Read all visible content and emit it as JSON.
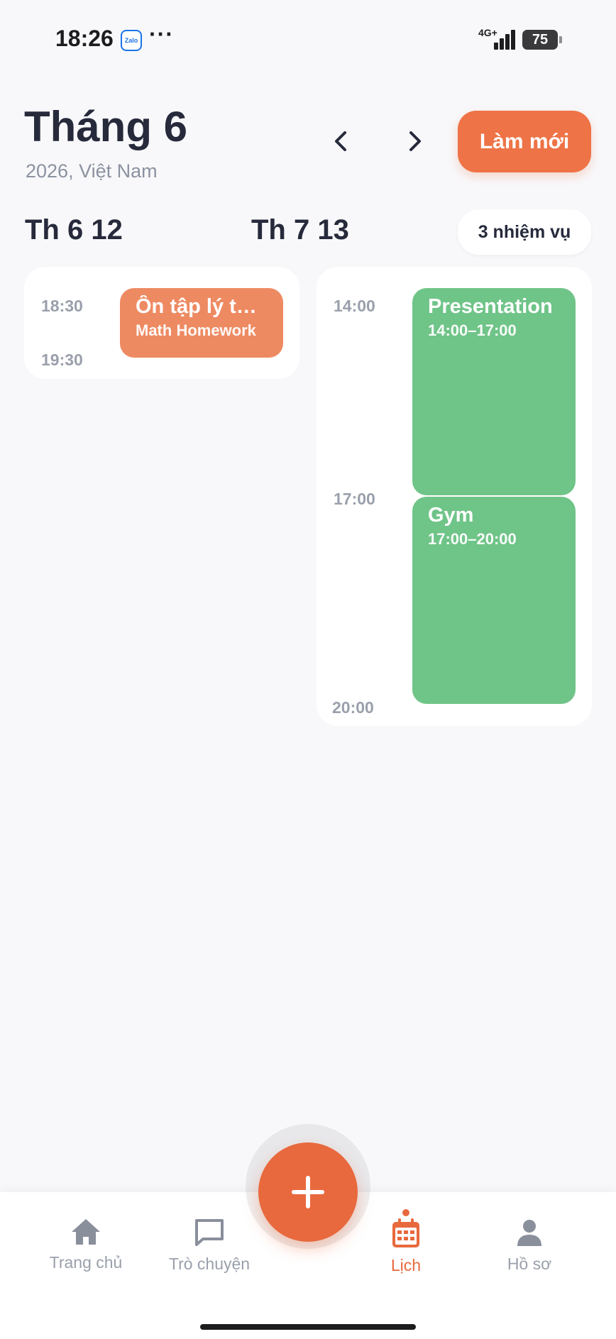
{
  "status_bar": {
    "time": "18:26",
    "zalo_label": "Zalo",
    "network": "4G+",
    "battery": "75"
  },
  "header": {
    "month": "Tháng 6",
    "subtitle": "2026, Việt Nam",
    "refresh_label": "Làm mới"
  },
  "days": [
    {
      "label": "Th 6 12",
      "times": [
        "18:30",
        "19:30"
      ],
      "events": [
        {
          "title": "Ôn tập lý thuyết",
          "subtitle": "Math Homework",
          "color": "#ee8a62"
        }
      ]
    },
    {
      "label": "Th 7 13",
      "task_count": "3 nhiệm vụ",
      "times": [
        "14:00",
        "17:00",
        "20:00"
      ],
      "events": [
        {
          "title": "Presentation",
          "subtitle": "14:00–17:00",
          "color": "#6fc488"
        },
        {
          "title": "Gym",
          "subtitle": "17:00–20:00",
          "color": "#6fc488"
        }
      ]
    }
  ],
  "bottom_nav": {
    "items": [
      {
        "label": "Trang chủ",
        "icon": "home-icon"
      },
      {
        "label": "Trò chuyện",
        "icon": "chat-icon"
      },
      {
        "label": "Lịch",
        "icon": "calendar-icon",
        "active": true
      },
      {
        "label": "Hồ sơ",
        "icon": "profile-icon"
      }
    ],
    "fab_icon": "plus-icon"
  },
  "colors": {
    "accent": "#e8693d",
    "event_orange": "#ee8a62",
    "event_green": "#6fc488",
    "background": "#f8f8fa"
  }
}
